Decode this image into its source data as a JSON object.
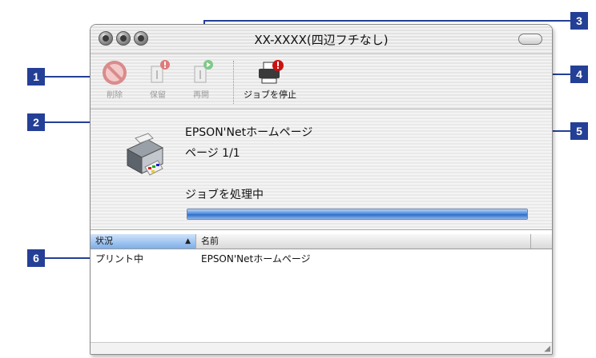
{
  "window": {
    "title": "XX-XXXX(四辺フチなし)",
    "traffic_lights": [
      "close",
      "minimize",
      "zoom"
    ]
  },
  "toolbar": {
    "delete_label": "削除",
    "hold_label": "保留",
    "resume_label": "再開",
    "stop_jobs_label": "ジョブを停止"
  },
  "status": {
    "document_name": "EPSON'Netホームページ",
    "page_info": "ページ 1/1",
    "processing_text": "ジョブを処理中",
    "progress": 1.0
  },
  "queue": {
    "columns": [
      "状況",
      "名前"
    ],
    "sorted_column_arrow": "▲",
    "rows": [
      {
        "status": "プリント中",
        "name": "EPSON'Netホームページ"
      }
    ]
  },
  "callouts": [
    "1",
    "2",
    "3",
    "4",
    "5",
    "6"
  ],
  "colors": {
    "callout": "#243f96",
    "progress": "#2f6cc6",
    "alert_badge": "#cc1111",
    "resume_badge": "#2aa830"
  }
}
